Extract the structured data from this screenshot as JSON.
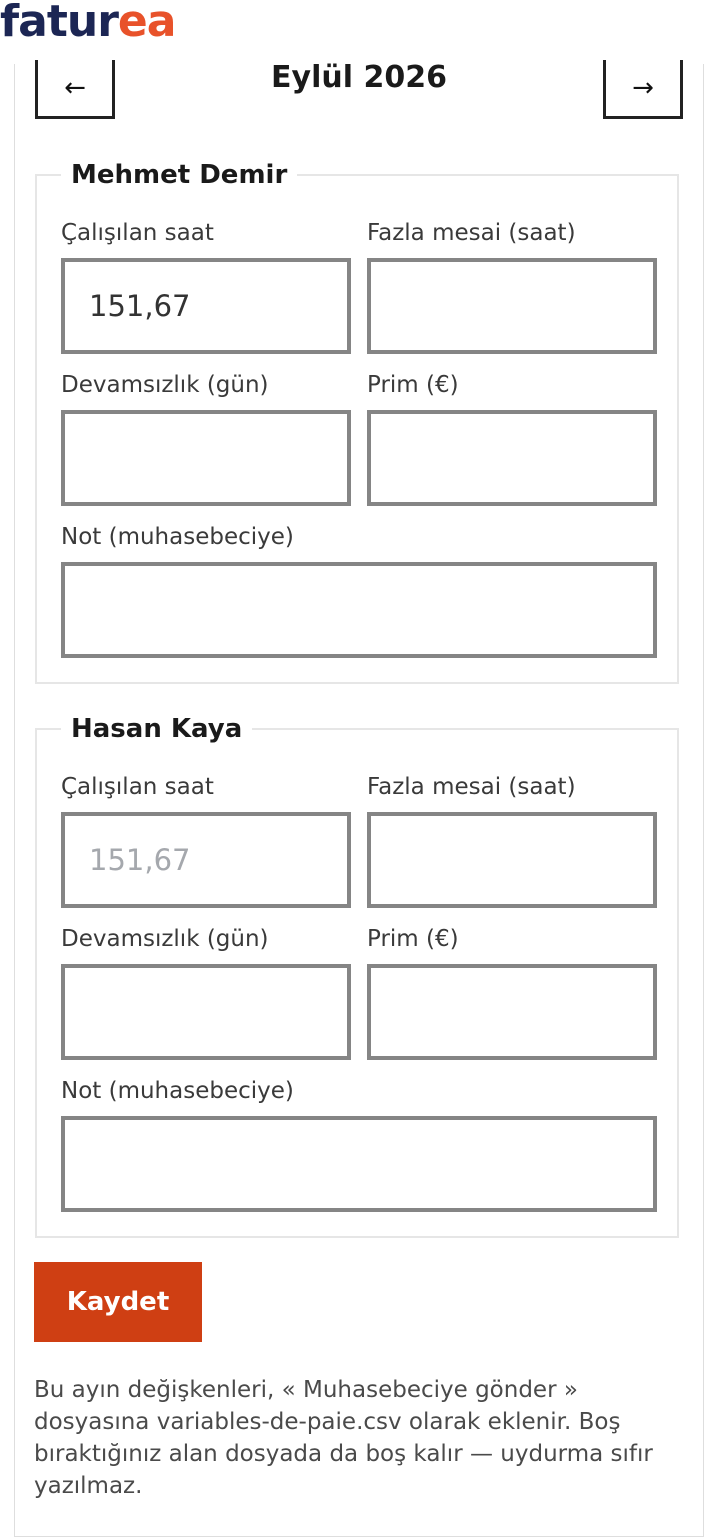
{
  "brand": {
    "logo_part1": "fatur",
    "logo_part2": "ea",
    "colors": {
      "navy": "#1c2654",
      "orange": "#e8522a",
      "button": "#cf3f13"
    }
  },
  "nav": {
    "prev_label": "←",
    "next_label": "→",
    "month": "Eylül 2026"
  },
  "employees": [
    {
      "name": "Mehmet Demir",
      "hours_label": "Çalışılan saat",
      "hours_value": "151,67",
      "overtime_label": "Fazla mesai (saat)",
      "overtime_value": "",
      "absence_label": "Devamsızlık (gün)",
      "absence_value": "",
      "bonus_label": "Prim (€)",
      "bonus_value": "",
      "note_label": "Not (muhasebeciye)",
      "note_value": ""
    },
    {
      "name": "Hasan Kaya",
      "hours_label": "Çalışılan saat",
      "hours_placeholder": "151,67",
      "overtime_label": "Fazla mesai (saat)",
      "overtime_value": "",
      "absence_label": "Devamsızlık (gün)",
      "absence_value": "",
      "bonus_label": "Prim (€)",
      "bonus_value": "",
      "note_label": "Not (muhasebeciye)",
      "note_value": ""
    }
  ],
  "save_label": "Kaydet",
  "help_text": "Bu ayın değişkenleri, « Muhasebeciye gönder » dosyasına variables-de-paie.csv olarak eklenir. Boş bıraktığınız alan dosyada da boş kalır — uydurma sıfır yazılmaz."
}
